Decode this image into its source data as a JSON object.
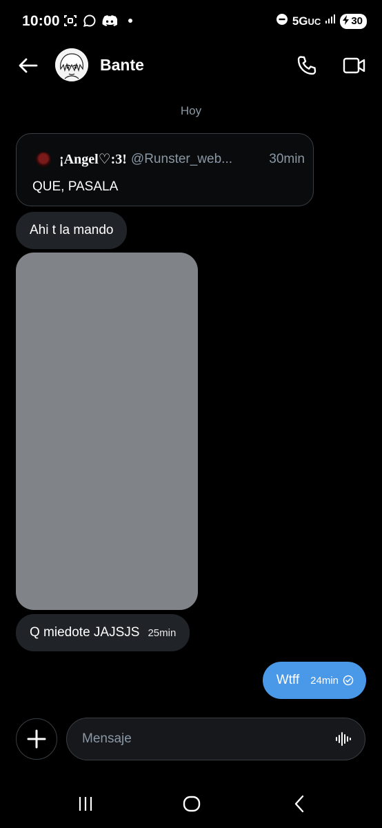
{
  "status_bar": {
    "time": "10:00",
    "network": "5G",
    "network_sub": "UC",
    "battery": "30",
    "icons": [
      "screenshot-icon",
      "chat-icon",
      "discord-icon",
      "dot-icon",
      "dnd-icon",
      "signal-icon",
      "charging-icon"
    ]
  },
  "header": {
    "name": "Bante",
    "icons": [
      "back-arrow-icon",
      "avatar",
      "phone-icon",
      "video-icon"
    ]
  },
  "conversation": {
    "day_label": "Hoy",
    "quote": {
      "author": "¡Angel♡:3!",
      "handle": "@Runster_web...",
      "time": "30min",
      "text": "QUE, PASALA"
    },
    "messages": [
      {
        "text": "Ahi t la mando",
        "direction": "incoming"
      },
      {
        "text": "Q miedote JAJSJS",
        "time": "25min",
        "direction": "incoming"
      },
      {
        "text": "Wtff",
        "time": "24min",
        "direction": "outgoing",
        "status": "sent"
      }
    ]
  },
  "composer": {
    "placeholder": "Mensaje"
  },
  "colors": {
    "background": "#000000",
    "incoming_bubble": "#202327",
    "outgoing_bubble": "#4a99e9",
    "muted_text": "#8b98a5",
    "border": "#3a3f44",
    "media_placeholder": "#808488"
  }
}
